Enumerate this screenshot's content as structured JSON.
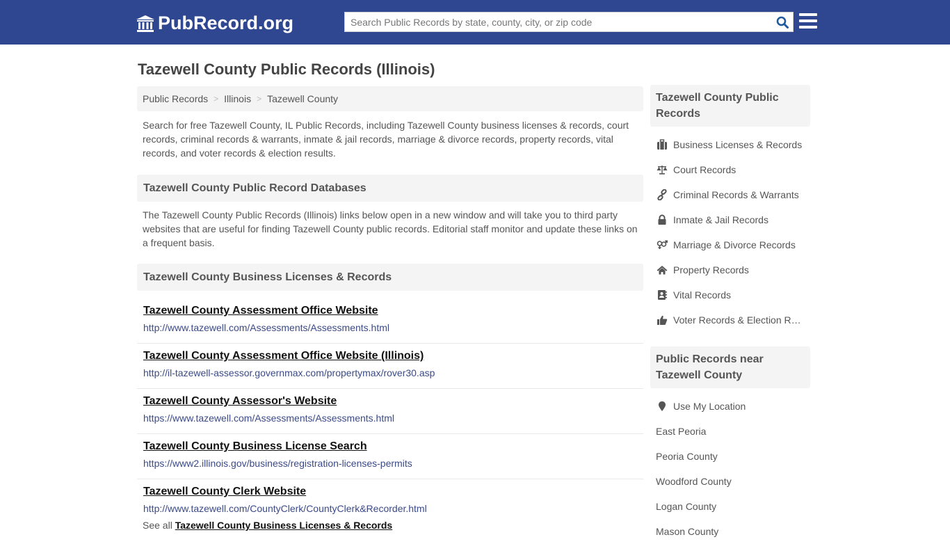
{
  "header": {
    "logo_text": "PubRecord.org",
    "search_placeholder": "Search Public Records by state, county, city, or zip code",
    "search_value": ""
  },
  "page": {
    "title": "Tazewell County Public Records (Illinois)"
  },
  "breadcrumb": [
    {
      "label": "Public Records"
    },
    {
      "label": "Illinois"
    },
    {
      "label": "Tazewell County"
    }
  ],
  "breadcrumb_separator": ">",
  "intro": "Search for free Tazewell County, IL Public Records, including Tazewell County business licenses & records, court records, criminal records & warrants, inmate & jail records, marriage & divorce records, property records, vital records, and voter records & election results.",
  "databases": {
    "heading": "Tazewell County Public Record Databases",
    "text": "The Tazewell County Public Records (Illinois) links below open in a new window and will take you to third party websites that are useful for finding Tazewell County public records. Editorial staff monitor and update these links on a frequent basis."
  },
  "business": {
    "heading": "Tazewell County Business Licenses & Records",
    "links": [
      {
        "title": "Tazewell County Assessment Office Website",
        "url": "http://www.tazewell.com/Assessments/Assessments.html"
      },
      {
        "title": "Tazewell County Assessment Office Website (Illinois)",
        "url": "http://il-tazewell-assessor.governmax.com/propertymax/rover30.asp"
      },
      {
        "title": "Tazewell County Assessor's Website",
        "url": "https://www.tazewell.com/Assessments/Assessments.html"
      },
      {
        "title": "Tazewell County Business License Search",
        "url": "https://www2.illinois.gov/business/registration-licenses-permits"
      },
      {
        "title": "Tazewell County Clerk Website",
        "url": "http://www.tazewell.com/CountyClerk/CountyClerk&Recorder.html"
      }
    ],
    "see_all_prefix": "See all",
    "see_all_link": "Tazewell County Business Licenses & Records"
  },
  "sidebar": {
    "records_heading": "Tazewell County Public Records",
    "records": [
      {
        "label": "Business Licenses & Records",
        "icon": "briefcase-icon"
      },
      {
        "label": "Court Records",
        "icon": "balance-scale-icon"
      },
      {
        "label": "Criminal Records & Warrants",
        "icon": "link-icon"
      },
      {
        "label": "Inmate & Jail Records",
        "icon": "lock-icon"
      },
      {
        "label": "Marriage & Divorce Records",
        "icon": "venus-mars-icon"
      },
      {
        "label": "Property Records",
        "icon": "home-icon"
      },
      {
        "label": "Vital Records",
        "icon": "address-book-icon"
      },
      {
        "label": "Voter Records & Election Results",
        "icon": "thumbs-up-icon"
      }
    ],
    "near_heading": "Public Records near Tazewell County",
    "use_location": "Use My Location",
    "nearby": [
      {
        "label": "East Peoria"
      },
      {
        "label": "Peoria County"
      },
      {
        "label": "Woodford County"
      },
      {
        "label": "Logan County"
      },
      {
        "label": "Mason County"
      }
    ]
  },
  "colors": {
    "header_bg": "#2f4790",
    "search_icon": "#1f5a9e",
    "panel_bg": "#f4f4f4",
    "url_text": "#3b4a88"
  }
}
